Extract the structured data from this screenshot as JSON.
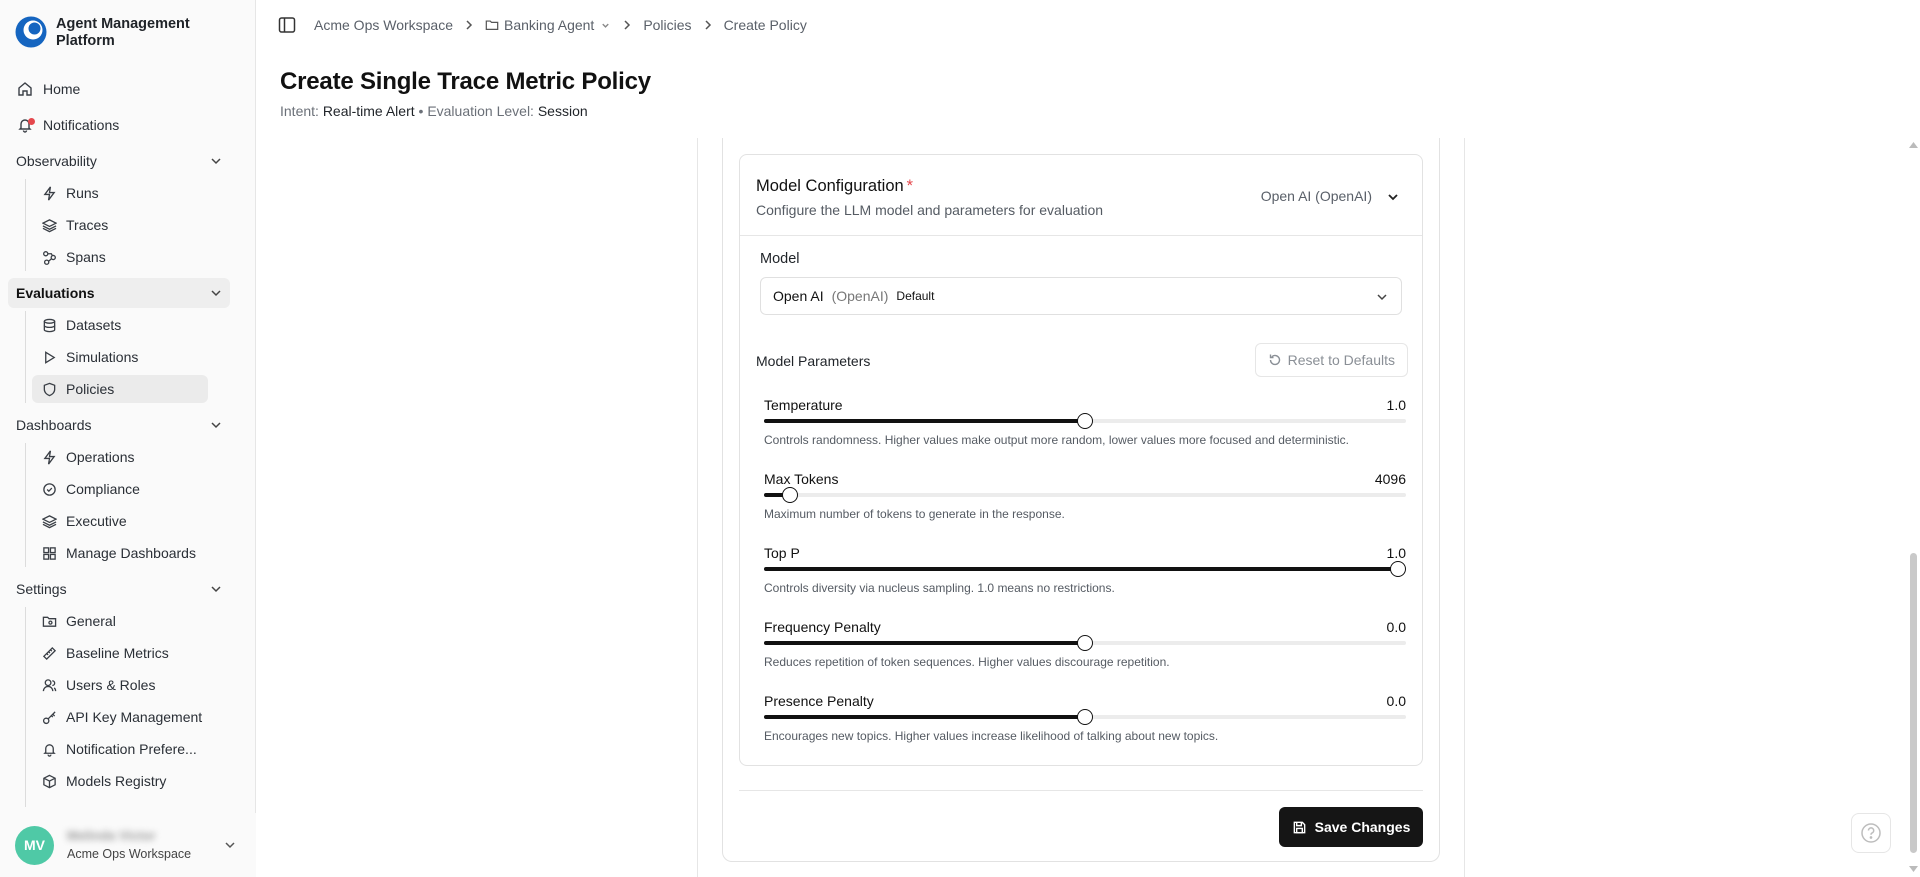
{
  "app": {
    "name": "Agent Management Platform"
  },
  "sidebar": {
    "home": "Home",
    "notifications": "Notifications",
    "observability": {
      "label": "Observability",
      "items": [
        "Runs",
        "Traces",
        "Spans"
      ]
    },
    "evaluations": {
      "label": "Evaluations",
      "items": [
        "Datasets",
        "Simulations",
        "Policies"
      ]
    },
    "dashboards": {
      "label": "Dashboards",
      "items": [
        "Operations",
        "Compliance",
        "Executive",
        "Manage Dashboards"
      ]
    },
    "settings": {
      "label": "Settings",
      "items": [
        "General",
        "Baseline Metrics",
        "Users & Roles",
        "API Key Management",
        "Notification Prefere...",
        "Models Registry"
      ]
    },
    "user": {
      "initials": "MV",
      "name": "Melinda Victor",
      "workspace": "Acme Ops Workspace"
    }
  },
  "breadcrumb": {
    "workspace": "Acme Ops Workspace",
    "agent": "Banking Agent",
    "section": "Policies",
    "current": "Create Policy"
  },
  "page": {
    "title": "Create Single Trace Metric Policy",
    "intent_label": "Intent:",
    "intent_value": "Real-time Alert",
    "separator": "•",
    "level_label": "Evaluation Level:",
    "level_value": "Session"
  },
  "model_config": {
    "title": "Model Configuration",
    "required_mark": "*",
    "description": "Configure the LLM model and parameters for evaluation",
    "selected_summary": "Open AI (OpenAI)",
    "model_label": "Model",
    "model_name": "Open AI",
    "model_provider": "(OpenAI)",
    "model_badge": "Default",
    "params_label": "Model Parameters",
    "reset_label": "Reset to Defaults",
    "params": [
      {
        "name": "Temperature",
        "value": "1.0",
        "level": 0.5,
        "help": "Controls randomness. Higher values make output more random, lower values more focused and deterministic."
      },
      {
        "name": "Max Tokens",
        "value": "4096",
        "level": 0.04,
        "help": "Maximum number of tokens to generate in the response."
      },
      {
        "name": "Top P",
        "value": "1.0",
        "level": 0.988,
        "help": "Controls diversity via nucleus sampling. 1.0 means no restrictions."
      },
      {
        "name": "Frequency Penalty",
        "value": "0.0",
        "level": 0.5,
        "help": "Reduces repetition of token sequences. Higher values discourage repetition."
      },
      {
        "name": "Presence Penalty",
        "value": "0.0",
        "level": 0.5,
        "help": "Encourages new topics. Higher values increase likelihood of talking about new topics."
      }
    ]
  },
  "actions": {
    "save_label": "Save Changes"
  },
  "colors": {
    "accent": "#151515",
    "required": "#e5484d",
    "avatar": "#4fc9a6",
    "brand": "#1565c0"
  }
}
